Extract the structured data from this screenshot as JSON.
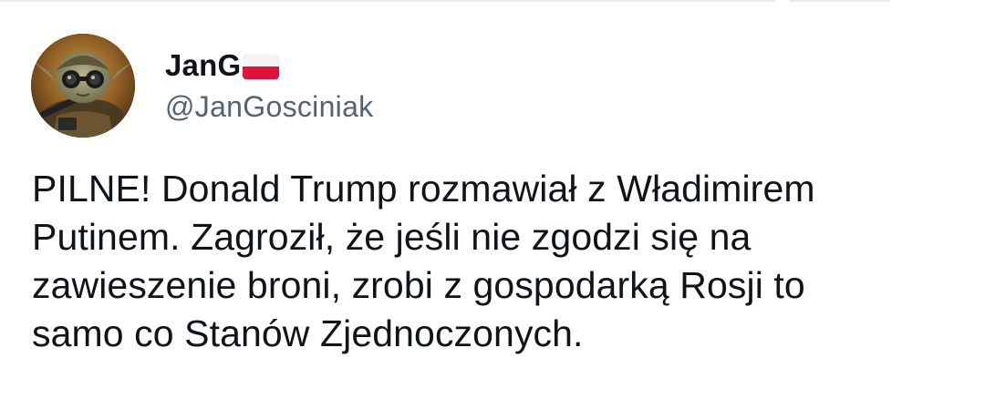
{
  "author": {
    "display_name": "JanG",
    "flag_icon": "poland-flag-icon",
    "handle": "@JanGosciniak",
    "avatar_icon": "avatar-armored-figure-icon"
  },
  "tweet": {
    "lines": [
      "PILNE! Donald Trump rozmawiał z Władimirem",
      "Putinem. Zagroził, że jeśli nie zgodzi się na",
      "zawieszenie broni, zrobi z gospodarką Rosji to",
      "samo co Stanów Zjednoczonych."
    ]
  },
  "colors": {
    "text": "#0f1419",
    "secondary": "#536471",
    "flag_red": "#dc143c",
    "flag_white": "#f4f4f4"
  }
}
